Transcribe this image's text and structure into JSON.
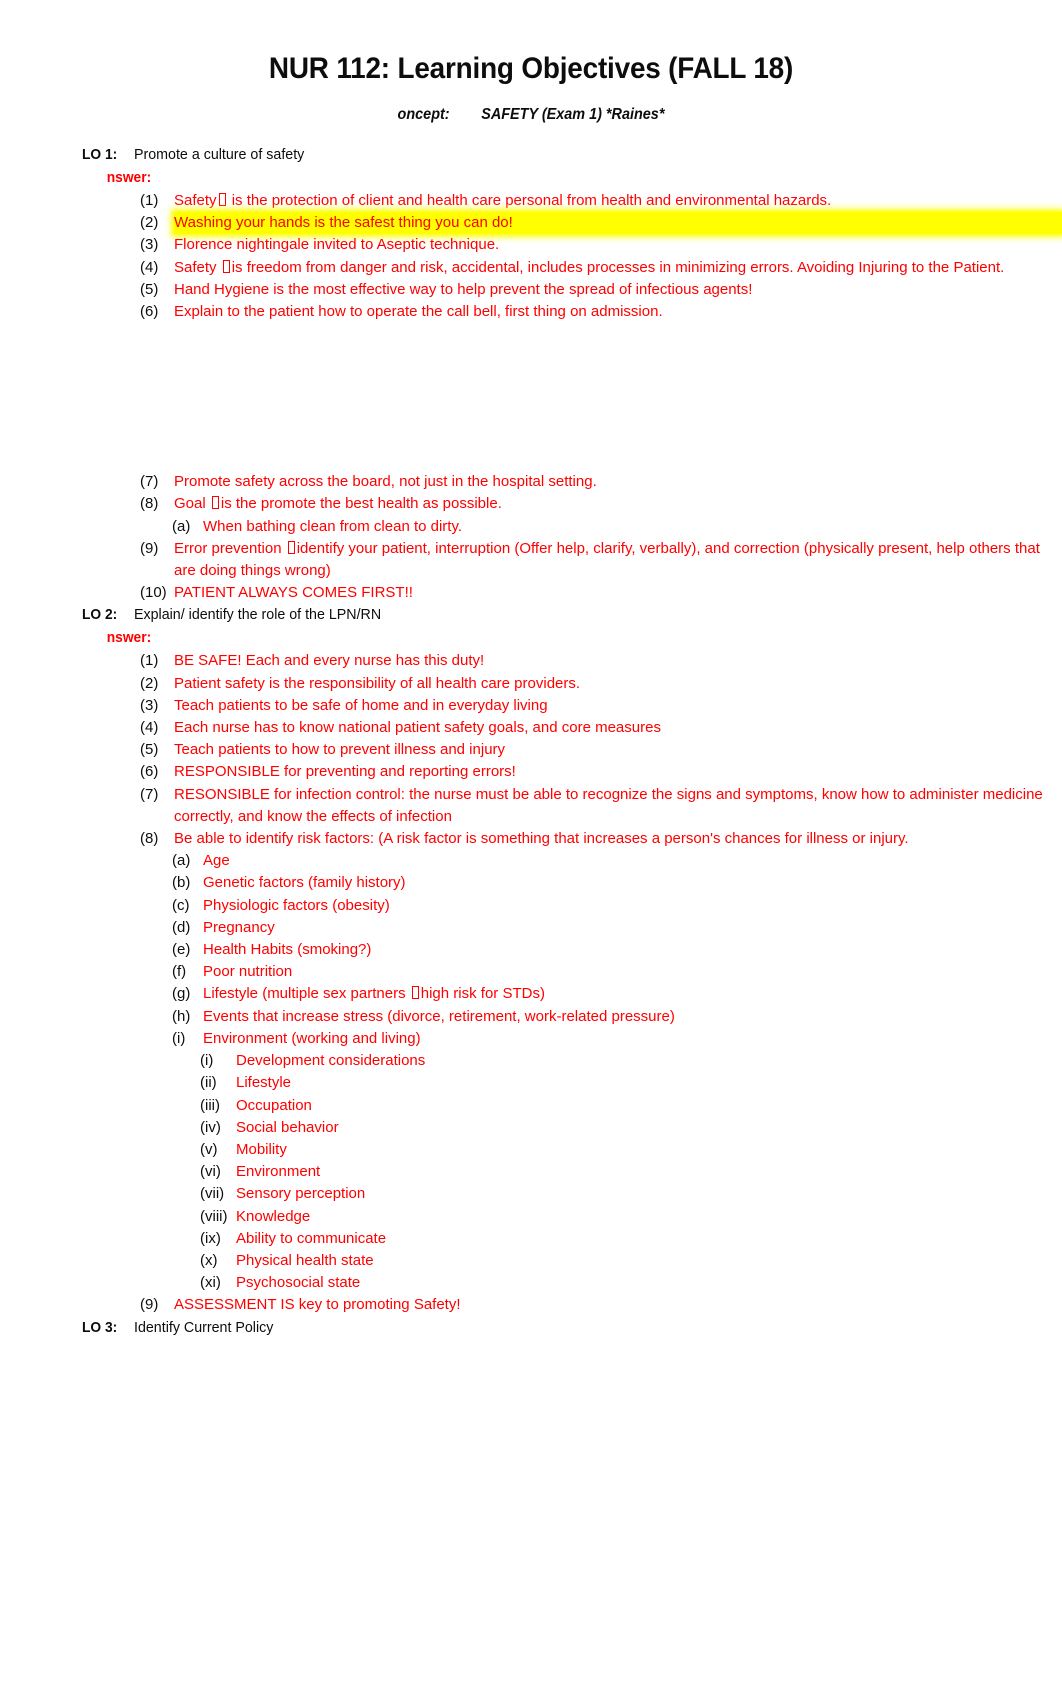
{
  "document": {
    "title": "NUR 112: Learning Objectives (FALL 18)",
    "concept_label": "oncept:",
    "concept_value": "SAFETY (Exam 1) *Raines*",
    "answer_label": "nswer:",
    "accent_color": "#FF0000",
    "highlight_color": "#FFFF00",
    "text_color": "#0D0D0D"
  },
  "objectives": [
    {
      "tag": "LO 1:",
      "text": "Promote a culture of safety",
      "items_before_gap": [
        {
          "marker": "(1)",
          "text_pre": "Safety",
          "tofu": true,
          "text_post": " is the protection of client and health care personal from health and environmental hazards.",
          "highlight": false
        },
        {
          "marker": "(2)",
          "text_pre": "Washing your hands is the safest thing you can do!",
          "tofu": false,
          "text_post": "",
          "highlight": true
        },
        {
          "marker": "(3)",
          "text_pre": "Florence nightingale invited to Aseptic technique.",
          "tofu": false,
          "text_post": "",
          "highlight": false
        },
        {
          "marker": "(4)",
          "text_pre": "Safety ",
          "tofu": true,
          "text_post": "is freedom from danger and risk, accidental, includes processes in minimizing errors. Avoiding Injuring to the Patient.",
          "highlight": false
        },
        {
          "marker": "(5)",
          "text_pre": "Hand Hygiene is the most effective way to help prevent the spread of infectious agents!",
          "tofu": false,
          "text_post": "",
          "highlight": false
        },
        {
          "marker": "(6)",
          "text_pre": "Explain to the patient how to operate the call bell, first thing on admission.",
          "tofu": false,
          "text_post": "",
          "highlight": false
        }
      ],
      "items_after_gap": [
        {
          "marker": "(7)",
          "text_pre": "Promote safety across the board, not just in the hospital setting.",
          "tofu": false,
          "text_post": "",
          "level": 1
        },
        {
          "marker": "(8)",
          "text_pre": "Goal ",
          "tofu": true,
          "text_post": "is the promote the best health as possible.",
          "level": 1
        },
        {
          "marker": "(a)",
          "text_pre": "When bathing clean from clean to dirty.",
          "tofu": false,
          "text_post": "",
          "level": 2
        },
        {
          "marker": "(9)",
          "text_pre": "Error prevention ",
          "tofu": true,
          "text_post": "identify your patient, interruption (Offer help, clarify, verbally), and correction (physically present, help others that are doing things wrong)",
          "level": 1
        },
        {
          "marker": "(10)",
          "text_pre": "PATIENT ALWAYS COMES FIRST!!",
          "tofu": false,
          "text_post": "",
          "level": 1
        }
      ]
    },
    {
      "tag": "LO 2:",
      "text": "Explain/ identify the role of the LPN/RN",
      "items": [
        {
          "marker": "(1)",
          "text_pre": "BE SAFE! Each and every nurse has this duty!",
          "tofu": false,
          "text_post": "",
          "level": 1
        },
        {
          "marker": "(2)",
          "text_pre": "Patient safety is the responsibility of all health care providers.",
          "tofu": false,
          "text_post": "",
          "level": 1
        },
        {
          "marker": "(3)",
          "text_pre": "Teach patients to be safe of home and in everyday living",
          "tofu": false,
          "text_post": "",
          "level": 1
        },
        {
          "marker": "(4)",
          "text_pre": "Each nurse has to know national patient safety goals, and core measures",
          "tofu": false,
          "text_post": "",
          "level": 1
        },
        {
          "marker": "(5)",
          "text_pre": "Teach patients to how to prevent illness and injury",
          "tofu": false,
          "text_post": "",
          "level": 1
        },
        {
          "marker": "(6)",
          "text_pre": "RESPONSIBLE for preventing and reporting errors!",
          "tofu": false,
          "text_post": "",
          "level": 1
        },
        {
          "marker": "(7)",
          "text_pre": "RESONSIBLE for infection control: the nurse must be able to recognize the signs and symptoms, know how to administer medicine correctly, and know the effects of infection",
          "tofu": false,
          "text_post": "",
          "level": 1
        },
        {
          "marker": "(8)",
          "text_pre": "Be able to identify risk factors: (A risk factor is something that increases a person's chances for illness or injury.",
          "tofu": false,
          "text_post": "",
          "level": 1
        },
        {
          "marker": "(a)",
          "text_pre": "Age",
          "tofu": false,
          "text_post": "",
          "level": 2
        },
        {
          "marker": "(b)",
          "text_pre": "Genetic factors (family history)",
          "tofu": false,
          "text_post": "",
          "level": 2
        },
        {
          "marker": "(c)",
          "text_pre": "Physiologic factors (obesity)",
          "tofu": false,
          "text_post": "",
          "level": 2
        },
        {
          "marker": "(d)",
          "text_pre": "Pregnancy",
          "tofu": false,
          "text_post": "",
          "level": 2
        },
        {
          "marker": "(e)",
          "text_pre": "Health Habits (smoking?)",
          "tofu": false,
          "text_post": "",
          "level": 2
        },
        {
          "marker": "(f)",
          "text_pre": "Poor nutrition",
          "tofu": false,
          "text_post": "",
          "level": 2
        },
        {
          "marker": "(g)",
          "text_pre": "Lifestyle (multiple sex partners ",
          "tofu": true,
          "text_post": "high risk for STDs)",
          "level": 2
        },
        {
          "marker": "(h)",
          "text_pre": "Events that increase stress (divorce, retirement, work-related pressure)",
          "tofu": false,
          "text_post": "",
          "level": 2
        },
        {
          "marker": "(i)",
          "text_pre": "Environment (working and living)",
          "tofu": false,
          "text_post": "",
          "level": 2
        },
        {
          "marker": "(i)",
          "text_pre": "Development considerations",
          "tofu": false,
          "text_post": "",
          "level": 3
        },
        {
          "marker": "(ii)",
          "text_pre": "Lifestyle",
          "tofu": false,
          "text_post": "",
          "level": 3
        },
        {
          "marker": "(iii)",
          "text_pre": "Occupation",
          "tofu": false,
          "text_post": "",
          "level": 3
        },
        {
          "marker": "(iv)",
          "text_pre": "Social behavior",
          "tofu": false,
          "text_post": "",
          "level": 3
        },
        {
          "marker": "(v)",
          "text_pre": "Mobility",
          "tofu": false,
          "text_post": "",
          "level": 3
        },
        {
          "marker": "(vi)",
          "text_pre": "Environment",
          "tofu": false,
          "text_post": "",
          "level": 3
        },
        {
          "marker": "(vii)",
          "text_pre": "Sensory perception",
          "tofu": false,
          "text_post": "",
          "level": 3
        },
        {
          "marker": "(viii)",
          "text_pre": "Knowledge",
          "tofu": false,
          "text_post": "",
          "level": 3
        },
        {
          "marker": "(ix)",
          "text_pre": "Ability to communicate",
          "tofu": false,
          "text_post": "",
          "level": 3
        },
        {
          "marker": "(x)",
          "text_pre": "Physical health state",
          "tofu": false,
          "text_post": "",
          "level": 3
        },
        {
          "marker": "(xi)",
          "text_pre": "Psychosocial state",
          "tofu": false,
          "text_post": "",
          "level": 3
        },
        {
          "marker": "(9)",
          "text_pre": "ASSESSMENT IS key to promoting Safety!",
          "tofu": false,
          "text_post": "",
          "level": 1
        }
      ]
    },
    {
      "tag": "LO 3:",
      "text": "Identify Current Policy",
      "items": []
    }
  ]
}
